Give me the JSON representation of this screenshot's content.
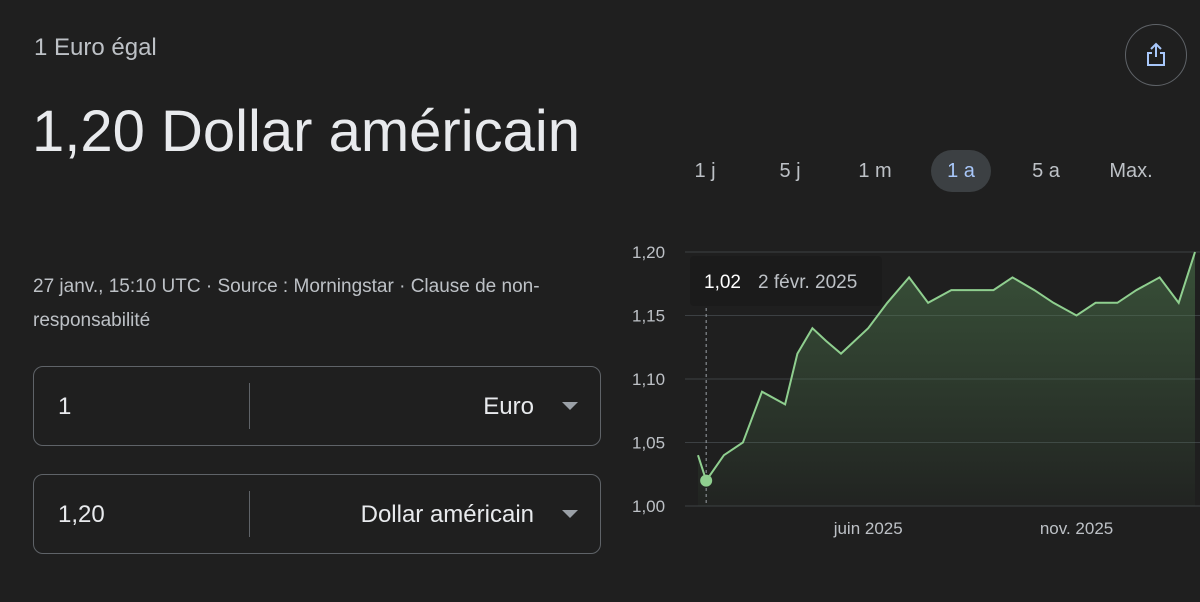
{
  "header": {
    "equal_label": "1 Euro égal",
    "rate_title": "1,20 Dollar américain",
    "meta": "27 janv., 15:10 UTC · Source : Morningstar · Clause de non-responsabilité"
  },
  "converter": {
    "from": {
      "amount": "1",
      "currency": "Euro"
    },
    "to": {
      "amount": "1,20",
      "currency": "Dollar américain"
    }
  },
  "tabs": [
    {
      "label": "1 j"
    },
    {
      "label": "5 j"
    },
    {
      "label": "1 m"
    },
    {
      "label": "1 a",
      "active": true
    },
    {
      "label": "5 a"
    },
    {
      "label": "Max."
    }
  ],
  "share_icon": "share-icon",
  "colors": {
    "line": "#8fcf8f",
    "active_tab_text": "#a8c7fa",
    "active_tab_bg": "#3c4043"
  },
  "tooltip": {
    "value": "1,02",
    "date": "2 févr. 2025"
  },
  "chart_data": {
    "type": "area",
    "y_ticks": [
      "1,20",
      "1,15",
      "1,10",
      "1,05",
      "1,00"
    ],
    "y_tick_values": [
      1.2,
      1.15,
      1.1,
      1.05,
      1.0
    ],
    "x_ticks": [
      "juin 2025",
      "nov. 2025"
    ],
    "ylim": [
      1.0,
      1.2
    ],
    "x": [
      "2025-01-27",
      "2025-02-02",
      "2025-02-15",
      "2025-03-01",
      "2025-03-15",
      "2025-04-01",
      "2025-04-10",
      "2025-04-21",
      "2025-05-01",
      "2025-05-12",
      "2025-06-01",
      "2025-06-15",
      "2025-07-01",
      "2025-07-15",
      "2025-08-01",
      "2025-08-15",
      "2025-09-01",
      "2025-09-15",
      "2025-10-01",
      "2025-10-15",
      "2025-11-01",
      "2025-11-15",
      "2025-12-01",
      "2025-12-15",
      "2026-01-01",
      "2026-01-15",
      "2026-01-27"
    ],
    "values": [
      1.04,
      1.02,
      1.04,
      1.05,
      1.09,
      1.08,
      1.12,
      1.14,
      1.13,
      1.12,
      1.14,
      1.16,
      1.18,
      1.16,
      1.17,
      1.17,
      1.17,
      1.18,
      1.17,
      1.16,
      1.15,
      1.16,
      1.16,
      1.17,
      1.18,
      1.16,
      1.2
    ]
  }
}
